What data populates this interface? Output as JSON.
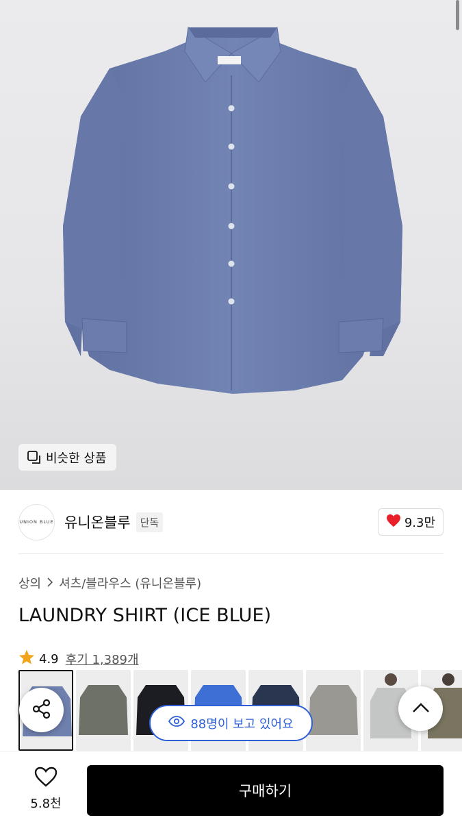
{
  "hero": {
    "similar_label": "비슷한 상품",
    "shirt_color": "#6f80ae"
  },
  "brand": {
    "logo_text": "UNION BLUE",
    "name": "유니온블루",
    "badge": "단독",
    "likes": "9.3만"
  },
  "breadcrumb": {
    "items": [
      "상의",
      "셔츠/블라우스 (유니온블루)"
    ],
    "separator": ">"
  },
  "product": {
    "title": "LAUNDRY SHIRT (ICE BLUE)",
    "rating": "4.9",
    "reviews": "후기 1,389개"
  },
  "thumbnails": [
    {
      "name": "ice-blue",
      "color": "#6f80ae"
    },
    {
      "name": "olive-grey",
      "color": "#6e7168"
    },
    {
      "name": "black",
      "color": "#1c1d22"
    },
    {
      "name": "blue",
      "color": "#3d6fd4"
    },
    {
      "name": "navy",
      "color": "#2a3550"
    },
    {
      "name": "grey",
      "color": "#9a9893"
    },
    {
      "name": "model-light",
      "color": "#c3c6c4"
    },
    {
      "name": "model-khaki",
      "color": "#7a7560"
    }
  ],
  "viewers_label": "88명이 보고 있어요",
  "bottom": {
    "wish_count": "5.8천",
    "buy_label": "구매하기"
  },
  "colors": {
    "accent_blue": "#2f5fd6",
    "heart_red": "#e8202a",
    "star_orange": "#f0a51c"
  },
  "icons": [
    "copy-icon",
    "heart-icon",
    "star-icon",
    "share-icon",
    "chevron-up-icon",
    "eye-icon",
    "heart-outline-icon",
    "chevron-right-icon"
  ]
}
